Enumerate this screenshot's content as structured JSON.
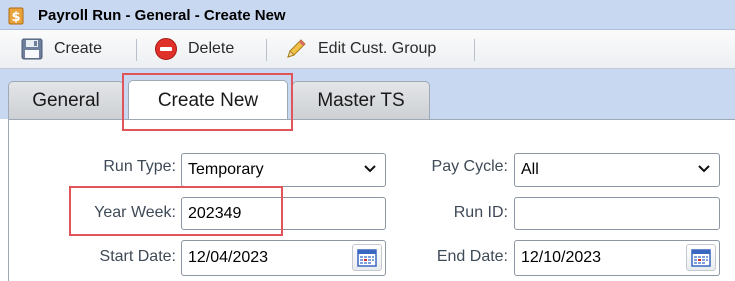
{
  "window": {
    "title": "Payroll Run - General - Create New",
    "title_icon": "dollar-document-icon"
  },
  "toolbar": {
    "create_label": "Create",
    "create_icon": "floppy-disk-icon",
    "delete_label": "Delete",
    "delete_icon": "no-entry-icon",
    "edit_group_label": "Edit Cust. Group",
    "edit_group_icon": "pencil-icon"
  },
  "tabs": [
    {
      "label": "General",
      "active": false
    },
    {
      "label": "Create New",
      "active": true
    },
    {
      "label": "Master TS",
      "active": false
    }
  ],
  "form": {
    "run_type": {
      "label": "Run Type:",
      "value": "Temporary"
    },
    "pay_cycle": {
      "label": "Pay Cycle:",
      "value": "All"
    },
    "year_week": {
      "label": "Year Week:",
      "value": "202349"
    },
    "run_id": {
      "label": "Run ID:",
      "value": ""
    },
    "start_date": {
      "label": "Start Date:",
      "value": "12/04/2023"
    },
    "end_date": {
      "label": "End Date:",
      "value": "12/10/2023"
    }
  },
  "colors": {
    "header_bg": "#c9d8f1",
    "highlight": "#e0555a",
    "label_text": "#3f4a57"
  }
}
